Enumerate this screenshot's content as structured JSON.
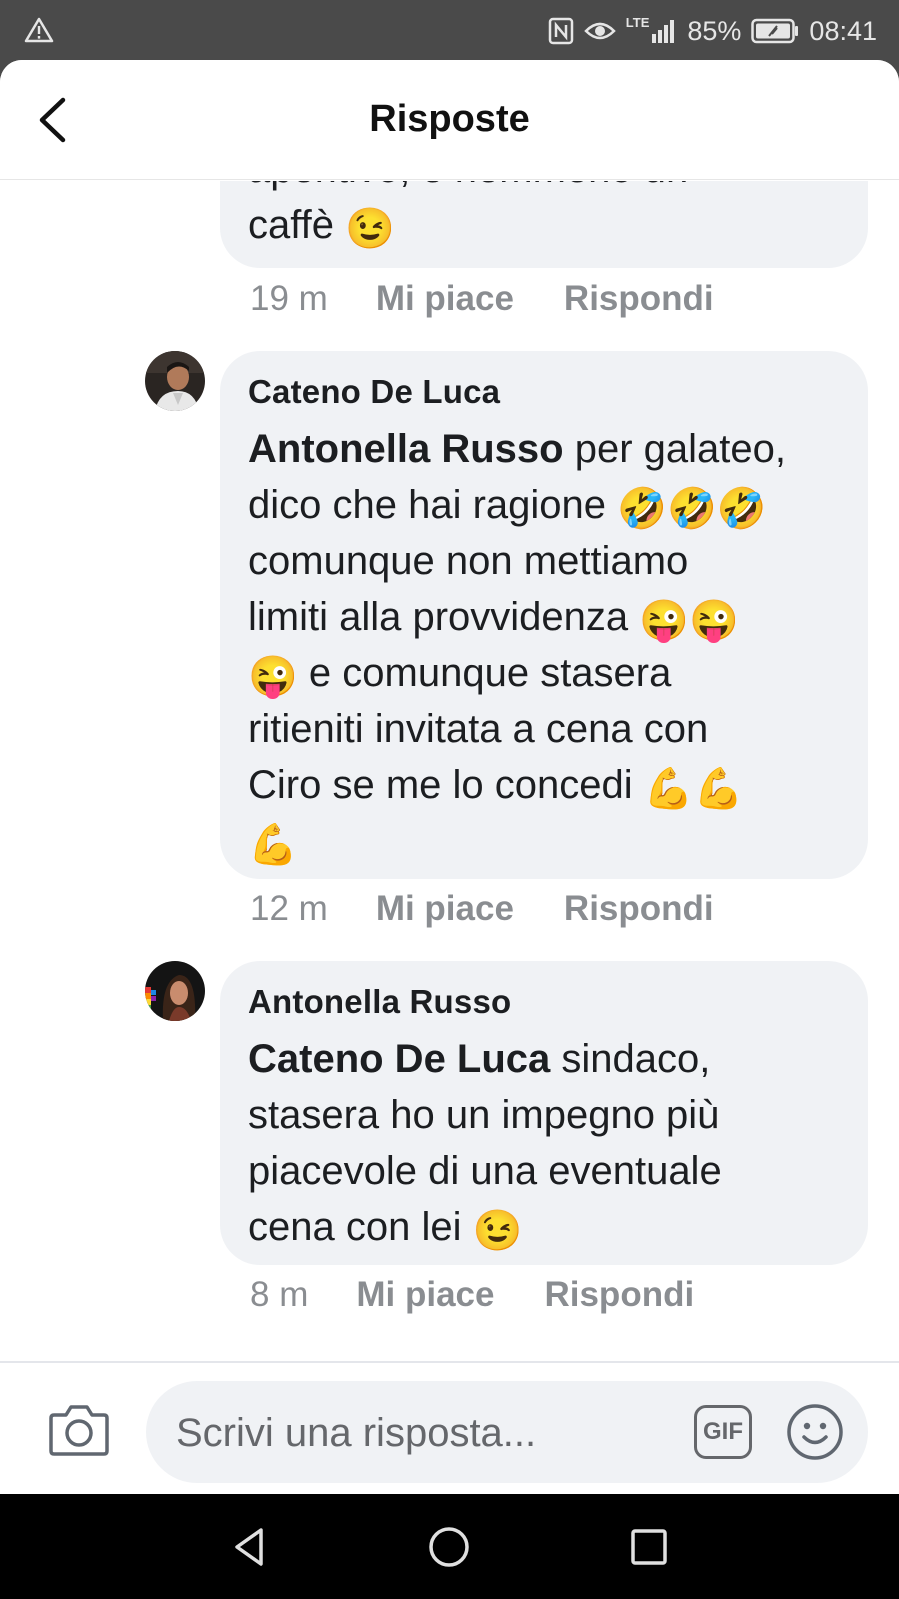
{
  "status_bar": {
    "signal_label": "LTE",
    "battery": "85%",
    "time": "08:41",
    "icons": [
      "warning-icon",
      "nfc-icon",
      "eye-icon",
      "signal-icon",
      "battery-icon"
    ]
  },
  "header": {
    "title": "Risposte",
    "back_icon": "back-arrow-icon"
  },
  "comments": [
    {
      "author": "",
      "text_lines": [
        "aperitivo, e nemmeno un",
        "caffè"
      ],
      "emoji": "😉",
      "time": "19 m",
      "like_label": "Mi piace",
      "reply_label": "Rispondi"
    },
    {
      "author": "Cateno De Luca",
      "mention": "Antonella Russo",
      "text_after_mention": " per galateo,",
      "line2": "dico che hai ragione ",
      "emoji_laugh": "🤣🤣🤣",
      "line3": "comunque non mettiamo",
      "line4": "limiti alla provvidenza ",
      "emoji_tongue2": "😜😜",
      "emoji_tongue1": "😜",
      "line5": " e comunque stasera",
      "line6": "ritieniti invitata a cena con",
      "line7": "Ciro se me lo concedi ",
      "emoji_muscle2": "💪💪",
      "emoji_muscle1": "💪",
      "time": "12 m",
      "like_label": "Mi piace",
      "reply_label": "Rispondi"
    },
    {
      "author": "Antonella Russo",
      "mention": "Cateno De Luca",
      "text_after_mention": " sindaco,",
      "line2": "stasera ho un impegno più",
      "line3": "piacevole di una eventuale",
      "line4": "cena con lei ",
      "emoji_wink": "😉",
      "time": "8 m",
      "like_label": "Mi piace",
      "reply_label": "Rispondi"
    }
  ],
  "composer": {
    "placeholder": "Scrivi una risposta...",
    "gif_label": "GIF",
    "camera_icon": "camera-icon",
    "emoji_icon": "smiley-icon"
  },
  "nav_bar": {
    "icons": [
      "back-triangle-icon",
      "home-circle-icon",
      "recents-square-icon"
    ]
  },
  "colors": {
    "bubble_bg": "#f0f2f5",
    "meta_text": "#8a8d91",
    "status_bar_bg": "#4a4a4a",
    "nav_bar_bg": "#000000"
  }
}
